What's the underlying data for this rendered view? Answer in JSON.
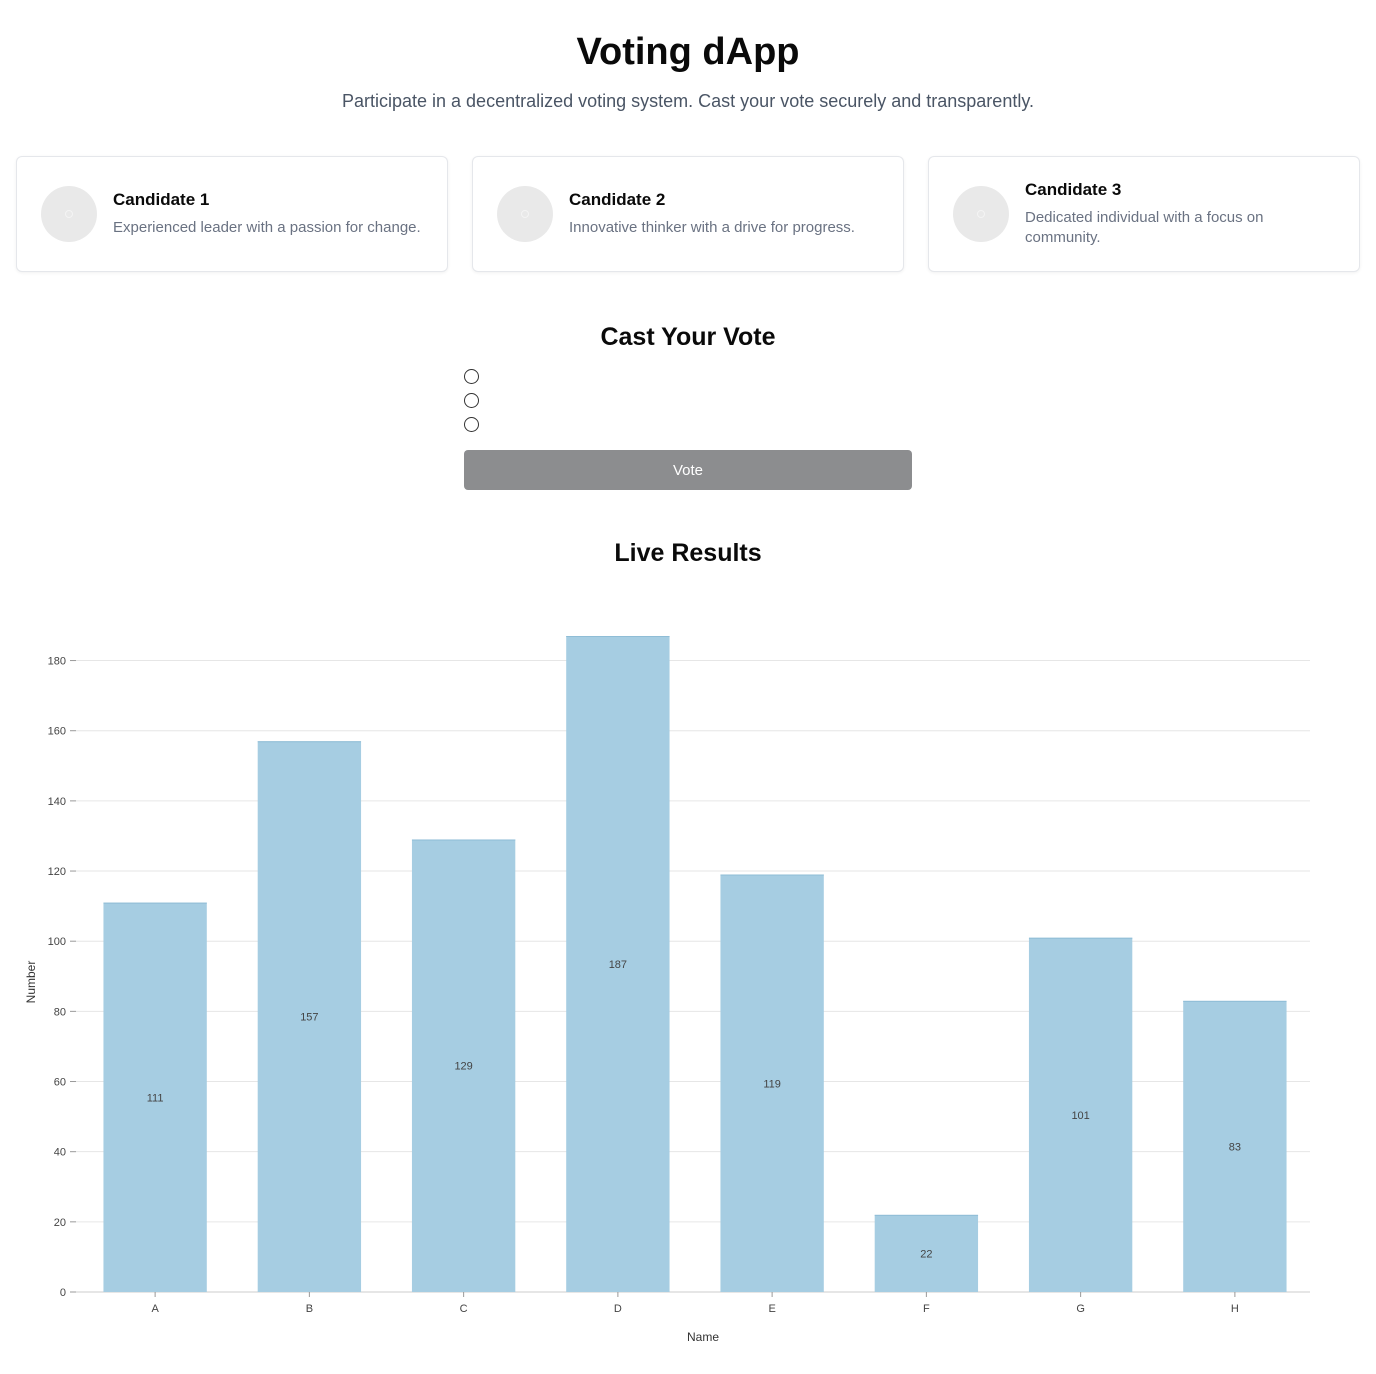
{
  "header": {
    "title": "Voting dApp",
    "subtitle": "Participate in a decentralized voting system. Cast your vote securely and transparently."
  },
  "candidates": [
    {
      "name": "Candidate 1",
      "description": "Experienced leader with a passion for change."
    },
    {
      "name": "Candidate 2",
      "description": "Innovative thinker with a drive for progress."
    },
    {
      "name": "Candidate 3",
      "description": "Dedicated individual with a focus on community."
    }
  ],
  "vote": {
    "title": "Cast Your Vote",
    "options_count": 3,
    "button_label": "Vote",
    "button_color": "#8c8d8f"
  },
  "results": {
    "title": "Live Results"
  },
  "chart_data": {
    "type": "bar",
    "categories": [
      "A",
      "B",
      "C",
      "D",
      "E",
      "F",
      "G",
      "H"
    ],
    "values": [
      111,
      157,
      129,
      187,
      119,
      22,
      101,
      83
    ],
    "xlabel": "Name",
    "ylabel": "Number",
    "ylim": [
      0,
      187
    ],
    "yticks": [
      0,
      20,
      40,
      60,
      80,
      100,
      120,
      140,
      160,
      180
    ],
    "grid": true,
    "bar_color": "#a6cde2"
  }
}
